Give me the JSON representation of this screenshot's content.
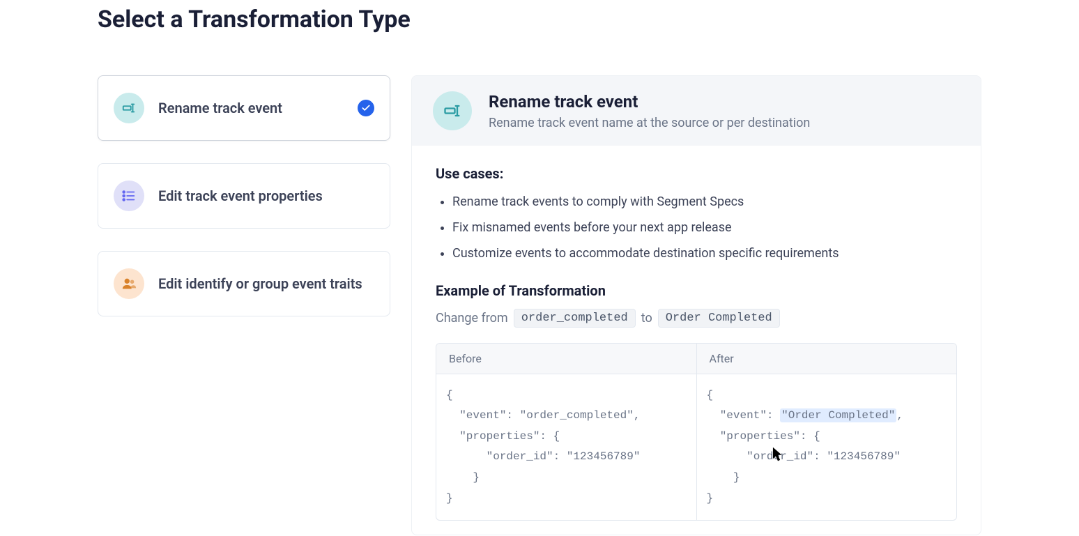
{
  "pageTitle": "Select a Transformation Type",
  "options": [
    {
      "label": "Rename track event",
      "selected": true
    },
    {
      "label": "Edit track event properties",
      "selected": false
    },
    {
      "label": "Edit identify or group event traits",
      "selected": false
    }
  ],
  "detail": {
    "title": "Rename track event",
    "subtitle": "Rename track event name at the source or per destination",
    "useCasesHeading": "Use cases:",
    "useCases": [
      "Rename track events to comply with Segment Specs",
      "Fix misnamed events before your next app release",
      "Customize events to accommodate destination specific requirements"
    ],
    "exampleHeading": "Example of Transformation",
    "change": {
      "prefix": "Change from",
      "from": "order_completed",
      "mid": "to",
      "to": "Order Completed"
    },
    "columns": {
      "beforeLabel": "Before",
      "afterLabel": "After",
      "before": "{\n  \"event\": \"order_completed\",\n  \"properties\": {\n      \"order_id\": \"123456789\"\n    }\n}",
      "after_prefix": "{\n  \"event\": ",
      "after_highlight": "\"Order Completed\"",
      "after_suffix": ",\n  \"properties\": {\n      \"order_id\": \"123456789\"\n    }\n}"
    }
  }
}
